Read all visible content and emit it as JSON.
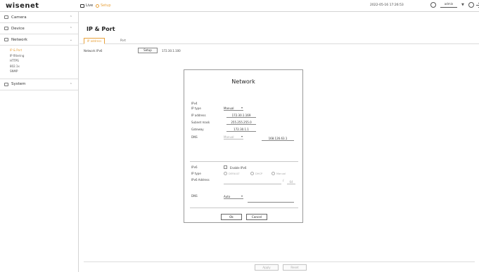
{
  "app": {
    "logo": "wisenet",
    "mode_live": "Live",
    "mode_setup": "Setup",
    "datetime": "2022-05-16 17:26:53",
    "user": "admin",
    "user_caret": "▼"
  },
  "sidebar": {
    "camera": "Camera",
    "device": "Device",
    "network": "Network",
    "network_items": [
      "IP & Port",
      "IP filtering",
      "HTTPS",
      "802.1x",
      "SNMP"
    ],
    "system": "System"
  },
  "main": {
    "title": "IP & Port",
    "tabs": [
      "IP address",
      "Port"
    ],
    "network_label": "Network IPv6",
    "setup_button": "Setup",
    "network_ip": "172.30.1.100"
  },
  "dialog": {
    "title": "Network",
    "ipv4": {
      "section": "IPv4",
      "ip_type_label": "IP type",
      "ip_type_value": "Manual",
      "ip_address_label": "IP address",
      "ip_address_value": "172.30.1.169",
      "subnet_label": "Subnet mask",
      "subnet_value": "255.255.255.0",
      "gateway_label": "Gateway",
      "gateway_value": "172.30.1.1",
      "dns_label": "DNS",
      "dns_mode": "Manual",
      "dns_value": "168.126.63.1"
    },
    "ipv6": {
      "section": "IPv6",
      "enable_label": "Enable IPv6",
      "ip_type_label": "IP type",
      "radio_options": [
        "DEFAULT",
        "DHCP",
        "Manual"
      ],
      "ipv6_address_label": "IPv6 Address",
      "prefix": "64",
      "dns_label": "DNS",
      "dns_mode": "Auto"
    },
    "ok": "Ok",
    "cancel": "Cancel"
  },
  "footer": {
    "apply": "Apply",
    "reset": "Reset"
  },
  "colors": {
    "accent": "#e8a23c",
    "border": "#d4d4d4"
  }
}
